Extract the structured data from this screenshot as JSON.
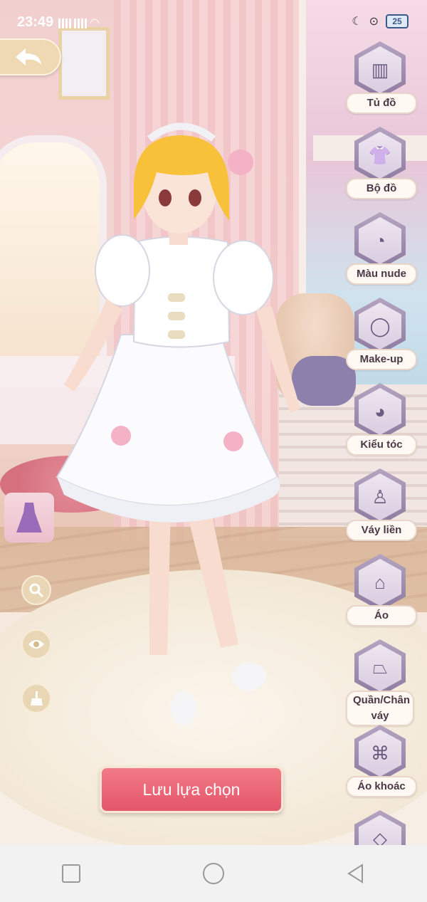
{
  "status_bar": {
    "time": "23:49",
    "battery": "25"
  },
  "menu": {
    "items": [
      {
        "label": "Tủ đồ",
        "icon": "wardrobe-icon"
      },
      {
        "label": "Bộ đồ",
        "icon": "outfit-set-icon"
      },
      {
        "label": "Màu nude",
        "icon": "skin-tone-icon"
      },
      {
        "label": "Make-up",
        "icon": "mirror-icon"
      },
      {
        "label": "Kiểu tóc",
        "icon": "hairstyle-icon"
      },
      {
        "label": "Váy liền",
        "icon": "dress-icon"
      },
      {
        "label": "Áo",
        "icon": "top-shirt-icon"
      },
      {
        "label": "Quần/Chân váy",
        "icon": "skirt-pants-icon"
      },
      {
        "label": "Áo khoác",
        "icon": "jacket-icon"
      },
      {
        "label": "",
        "icon": "accessory-icon"
      }
    ]
  },
  "actions": {
    "save_label": "Lưu lựa chọn"
  },
  "colors": {
    "save_button": "#e2566a",
    "menu_hex": "#8d7aa0",
    "label_bg": "#fff8f3"
  }
}
